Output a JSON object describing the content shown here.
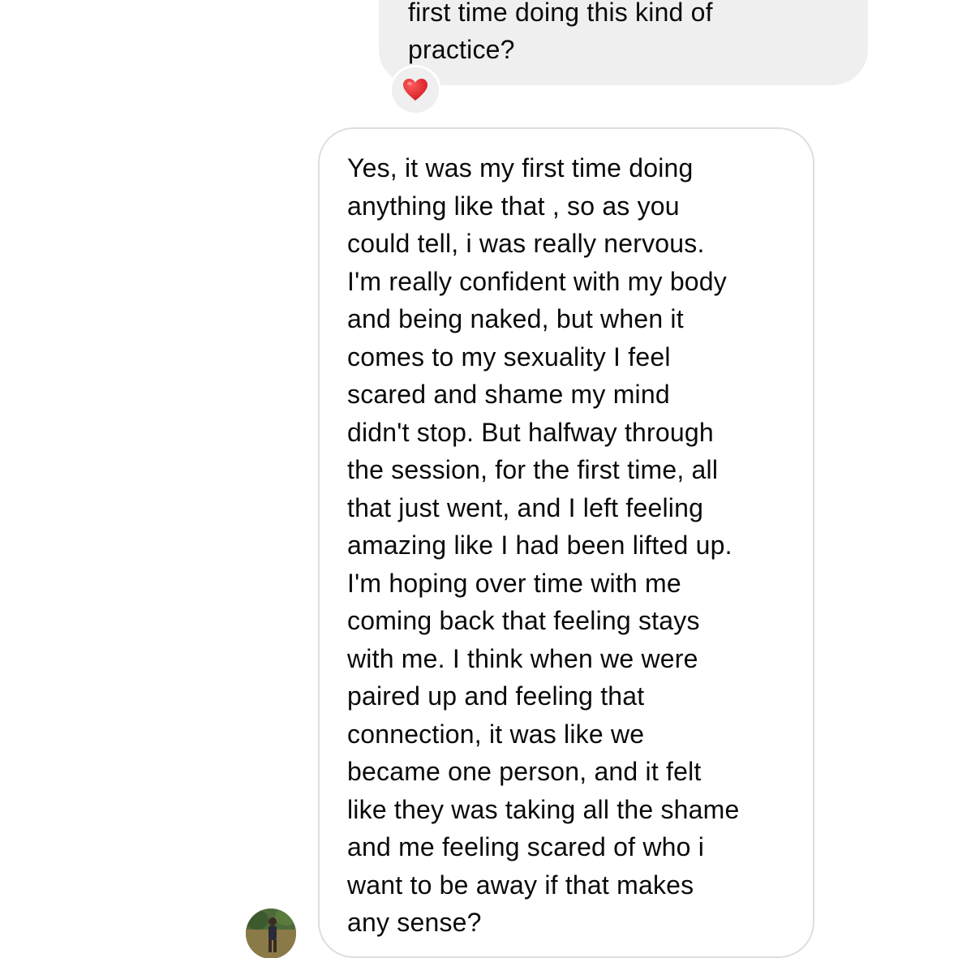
{
  "thread": {
    "outgoing_message": {
      "lines": [
        "first time doing this kind of",
        "practice?"
      ],
      "reaction": "heart-emoji"
    },
    "incoming_message": {
      "lines": [
        "Yes, it was my first time doing",
        "anything like that , so as you",
        "could tell, i was really nervous.",
        "I'm really confident with my body",
        "and being naked, but when it",
        "comes to my sexuality I feel",
        "scared and shame my mind",
        "didn't stop. But halfway through",
        "the session, for the first time, all",
        "that just went, and I left feeling",
        "amazing like I had been lifted up.",
        "I'm hoping over time with me",
        "coming back that feeling stays",
        "with me. I think when we were",
        "paired up and feeling that",
        "connection, it was like we",
        "became one person, and it felt",
        "like they was taking all the shame",
        "and me feeling scared of who i",
        "want to be away if that makes",
        "any sense?"
      ]
    }
  },
  "colors": {
    "outgoing_bubble": "#efefef",
    "incoming_border": "#dedede",
    "heart": "#e0242c",
    "text": "#0a0a0a"
  }
}
